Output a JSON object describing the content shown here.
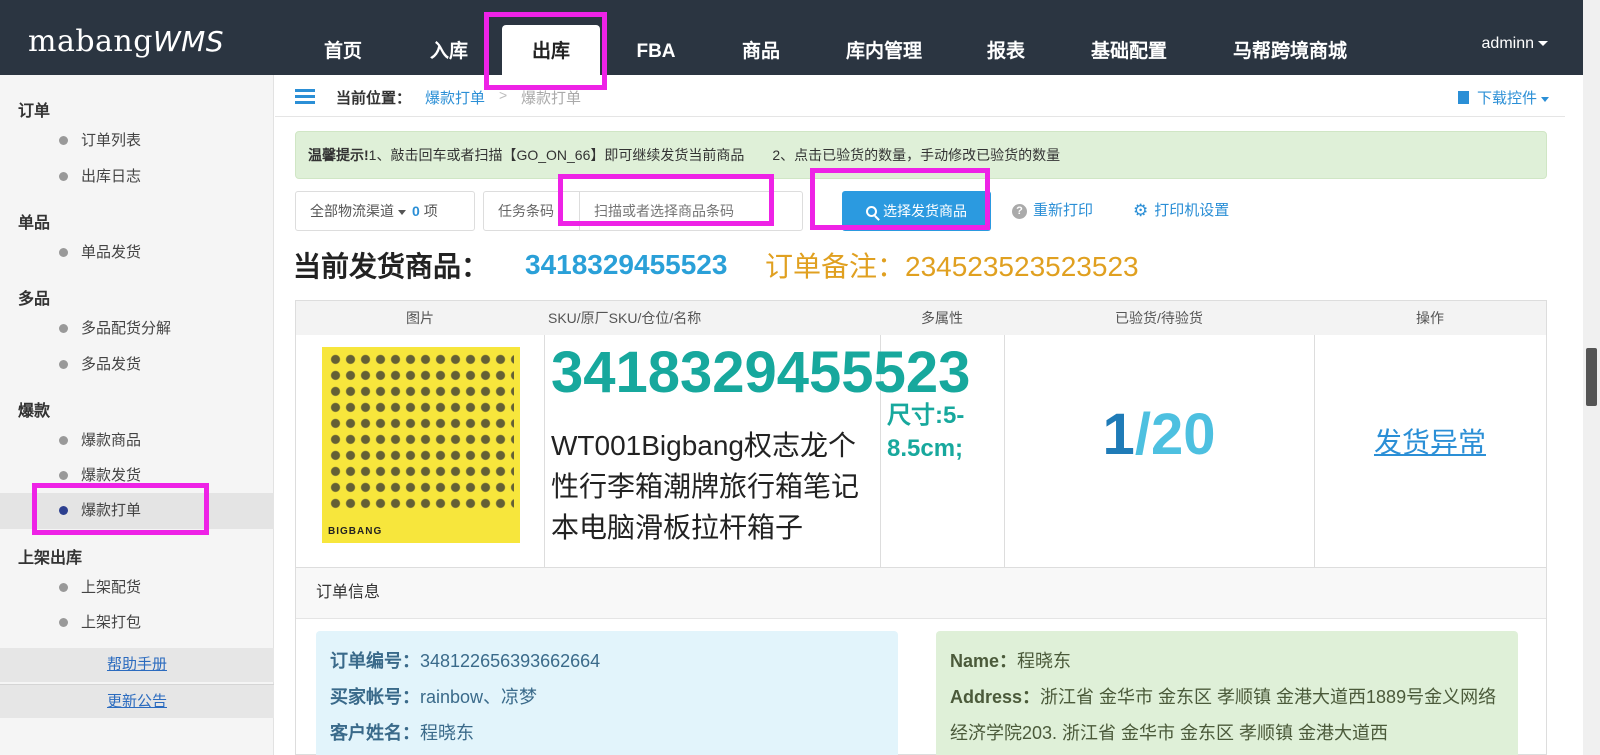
{
  "app": {
    "logo_main": "mabang",
    "logo_sub": "WMS",
    "user": "adminn"
  },
  "nav": [
    {
      "label": "首页"
    },
    {
      "label": "入库"
    },
    {
      "label": "出库"
    },
    {
      "label": "FBA"
    },
    {
      "label": "商品"
    },
    {
      "label": "库内管理"
    },
    {
      "label": "报表"
    },
    {
      "label": "基础配置"
    },
    {
      "label": "马帮跨境商城"
    }
  ],
  "sidebar": {
    "groups": [
      "订单",
      "单品",
      "多品",
      "爆款",
      "上架出库"
    ],
    "items": [
      "订单列表",
      "出库日志",
      "单品发货",
      "多品配货分解",
      "多品发货",
      "爆款商品",
      "爆款发货",
      "爆款打单",
      "上架配货",
      "上架打包"
    ],
    "links": [
      "帮助手册",
      "更新公告"
    ]
  },
  "breadcrumb": {
    "label": "当前位置：",
    "first": "爆款打单",
    "sep": ">",
    "current": "爆款打单",
    "download": "下载控件"
  },
  "tip": {
    "bold": "温馨提示!",
    "text": "1、敲击回车或者扫描【GO_ON_66】即可继续发货当前商品　　2、点击已验货的数量，手动修改已验货的数量"
  },
  "toolbar": {
    "channel": "全部物流渠道",
    "count": "0",
    "count_unit": "项",
    "task_label": "任务条码",
    "scan_placeholder": "扫描或者选择商品条码",
    "select_btn": "选择发货商品",
    "reprint": "重新打印",
    "printer": "打印机设置"
  },
  "current": {
    "title": "当前发货商品：",
    "sku": "3418329455523",
    "note": "订单备注：234523523523523"
  },
  "table": {
    "headers": [
      "图片",
      "SKU/原厂SKU/仓位/名称",
      "多属性",
      "已验货/待验货",
      "操作"
    ],
    "row": {
      "image_brand": "BIGBANG",
      "sku": "3418329455523",
      "name": "WT001Bigbang权志龙个性行李箱潮牌旅行箱笔记本电脑滑板拉杆箱子",
      "attr": "尺寸:5-8.5cm;",
      "checked": "1",
      "slash": "/",
      "pending": "20",
      "action": "发货异常"
    }
  },
  "order": {
    "title": "订单信息",
    "left": [
      {
        "k": "订单编号：",
        "v": "348122656393662664"
      },
      {
        "k": "买家帐号：",
        "v": "rainbow、凉梦"
      },
      {
        "k": "客户姓名：",
        "v": "程晓东"
      }
    ],
    "right": {
      "name_k": "Name：",
      "name_v": "程晓东",
      "addr_k": "Address：",
      "addr_v": "浙江省 金华市 金东区 孝顺镇 金港大道西1889号金义网络经济学院203. 浙江省 金华市 金东区 孝顺镇 金港大道西"
    }
  },
  "colors": {
    "highlight": "#ee22e6",
    "nav_bg": "#2b3541",
    "accent": "#2b8fd6",
    "sku_teal": "#17a89d"
  }
}
